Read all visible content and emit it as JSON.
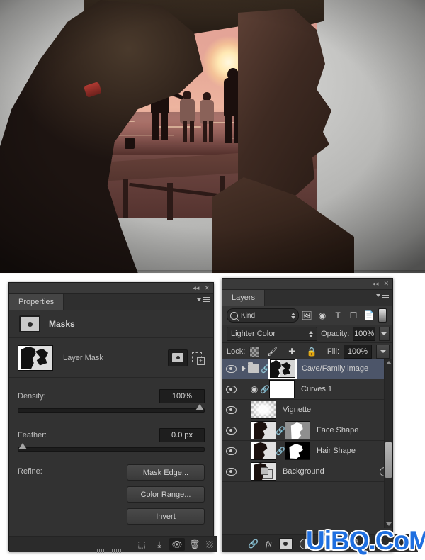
{
  "canvas": {
    "description": "double-exposure portrait of a woman's profile with a family silhouette on a pier at sunset inside her hair"
  },
  "properties_panel": {
    "titlebar": {
      "collapse_icon": "double-chevron-left-icon",
      "close_icon": "close-icon"
    },
    "tab_label": "Properties",
    "menu_icon": "panel-menu-icon",
    "header_label": "Masks",
    "header_icon": "pixel-mask-icon",
    "mask_row": {
      "thumb_icon": "layer-mask-thumbnail",
      "label": "Layer Mask",
      "pixel_mask_button": "pixel-mask-button",
      "vector_mask_button": "vector-mask-button"
    },
    "density": {
      "label": "Density:",
      "value": "100%",
      "slider_pct": 100
    },
    "feather": {
      "label": "Feather:",
      "value": "0.0 px",
      "slider_pct": 0
    },
    "refine": {
      "label": "Refine:",
      "buttons": [
        "Mask Edge...",
        "Color Range...",
        "Invert"
      ]
    },
    "footer_icons": [
      "load-selection-icon",
      "apply-mask-icon",
      "toggle-mask-visibility-icon",
      "delete-mask-icon"
    ]
  },
  "layers_panel": {
    "titlebar": {
      "collapse_icon": "double-chevron-left-icon",
      "close_icon": "close-icon"
    },
    "tab_label": "Layers",
    "menu_icon": "panel-menu-icon",
    "filter": {
      "kind_label": "Kind",
      "search_icon": "search-icon",
      "type_icons": [
        "pixel-filter-icon",
        "adjustment-filter-icon",
        "type-filter-icon",
        "shape-filter-icon",
        "smart-object-filter-icon"
      ],
      "toggle_icon": "filter-toggle-switch"
    },
    "blend_mode": "Lighter Color",
    "opacity": {
      "label": "Opacity:",
      "value": "100%"
    },
    "fill": {
      "label": "Fill:",
      "value": "100%"
    },
    "lock": {
      "label": "Lock:",
      "icons": [
        "lock-transparency-icon",
        "lock-image-icon",
        "lock-position-icon",
        "lock-all-icon"
      ]
    },
    "layers": [
      {
        "name": "Cave/Family image",
        "visible": true,
        "selected": true,
        "type": "group",
        "expandable": true,
        "linked": true,
        "thumb": "cave-family-thumb",
        "mask_selected": true
      },
      {
        "name": "Curves 1",
        "visible": true,
        "selected": false,
        "type": "adjustment",
        "linked": true,
        "thumb": "white-mask-thumb"
      },
      {
        "name": "Vignette",
        "visible": true,
        "selected": false,
        "type": "pixel",
        "linked": false,
        "thumb": "vignette-checker-thumb"
      },
      {
        "name": "Face Shape",
        "visible": true,
        "selected": false,
        "type": "pixel",
        "linked": true,
        "thumb": "face-shape-thumb",
        "mask_thumb": "face-mask-gray"
      },
      {
        "name": "Hair Shape",
        "visible": true,
        "selected": false,
        "type": "pixel",
        "linked": true,
        "thumb": "hair-shape-thumb",
        "mask_thumb": "hair-mask-black"
      },
      {
        "name": "Background",
        "visible": true,
        "selected": false,
        "type": "background",
        "linked": false,
        "thumb": "background-thumb",
        "locked": true
      }
    ],
    "footer_icons": [
      "link-layers-icon",
      "layer-style-fx-icon",
      "add-mask-icon",
      "new-adjustment-layer-icon",
      "new-group-icon",
      "new-layer-icon",
      "delete-layer-icon"
    ]
  },
  "watermark": {
    "text": "UiBQ.CoM",
    "color": "#1f6fe0"
  }
}
